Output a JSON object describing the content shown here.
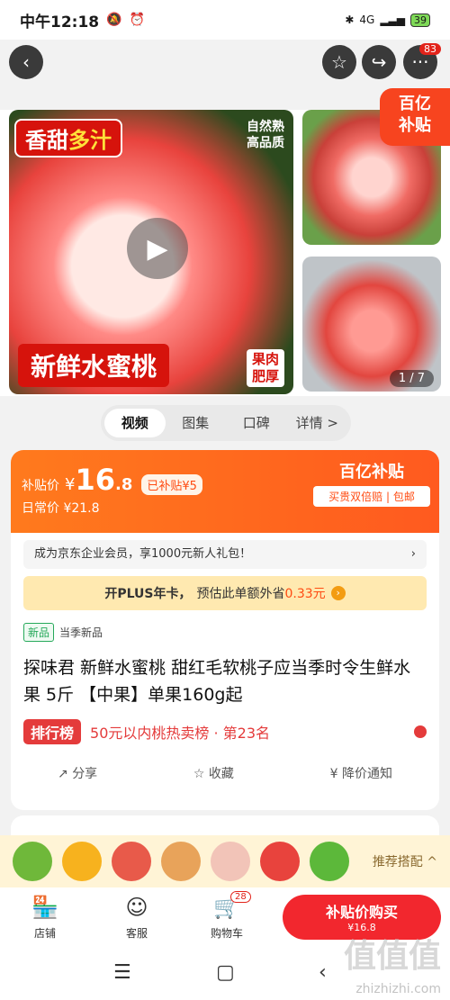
{
  "status": {
    "time": "中午12:18",
    "network": "4G",
    "battery": "39"
  },
  "nav": {
    "more_badge": "83"
  },
  "gallery": {
    "tag_sweet_a": "香甜",
    "tag_sweet_b": "多汁",
    "tag_natural_1": "自然熟",
    "tag_natural_2": "高品质",
    "tag_fresh": "新鲜水蜜桃",
    "tag_flesh_1": "果肉",
    "tag_flesh_2": "肥厚",
    "page": "1 / 7",
    "subsidy_1": "百亿",
    "subsidy_2": "补贴"
  },
  "tabs": [
    "视频",
    "图集",
    "口碑",
    "详情 >"
  ],
  "price": {
    "label": "补贴价",
    "currency": "¥",
    "int": "16",
    ".dec": ".8",
    "dec": ".8",
    "saved": "已补贴¥5",
    "daily": "日常价 ¥21.8",
    "brand": "百亿补贴",
    "brand_sub": "买贵双倍赔 | 包邮"
  },
  "member": {
    "text": "成为京东企业会员，享1000元新人礼包！",
    "arrow": "›"
  },
  "plus": {
    "label": "开PLUS年卡，",
    "text": "预估此单额外省",
    "amount": "0.33元",
    "arrow": "›"
  },
  "tags": {
    "new": "新品",
    "season": "当季新品"
  },
  "title": "探味君 新鲜水蜜桃 甜红毛软桃子应当季时令生鲜水果 5斤 【中果】单果160g起",
  "rank": {
    "badge": "排行榜",
    "text": "50元以内桃热卖榜 · 第23名"
  },
  "actions": {
    "share": "分享",
    "fav": "收藏",
    "notify": "降价通知"
  },
  "reco": {
    "label": "推荐搭配 ^"
  },
  "bottom": {
    "shop": "店铺",
    "service": "客服",
    "cart": "购物车",
    "cart_badge": "28",
    "buy": "补贴价购买",
    "buy_price": "¥16.8"
  },
  "watermark": {
    "big": "值值值",
    "small": "zhizhizhi.com"
  }
}
